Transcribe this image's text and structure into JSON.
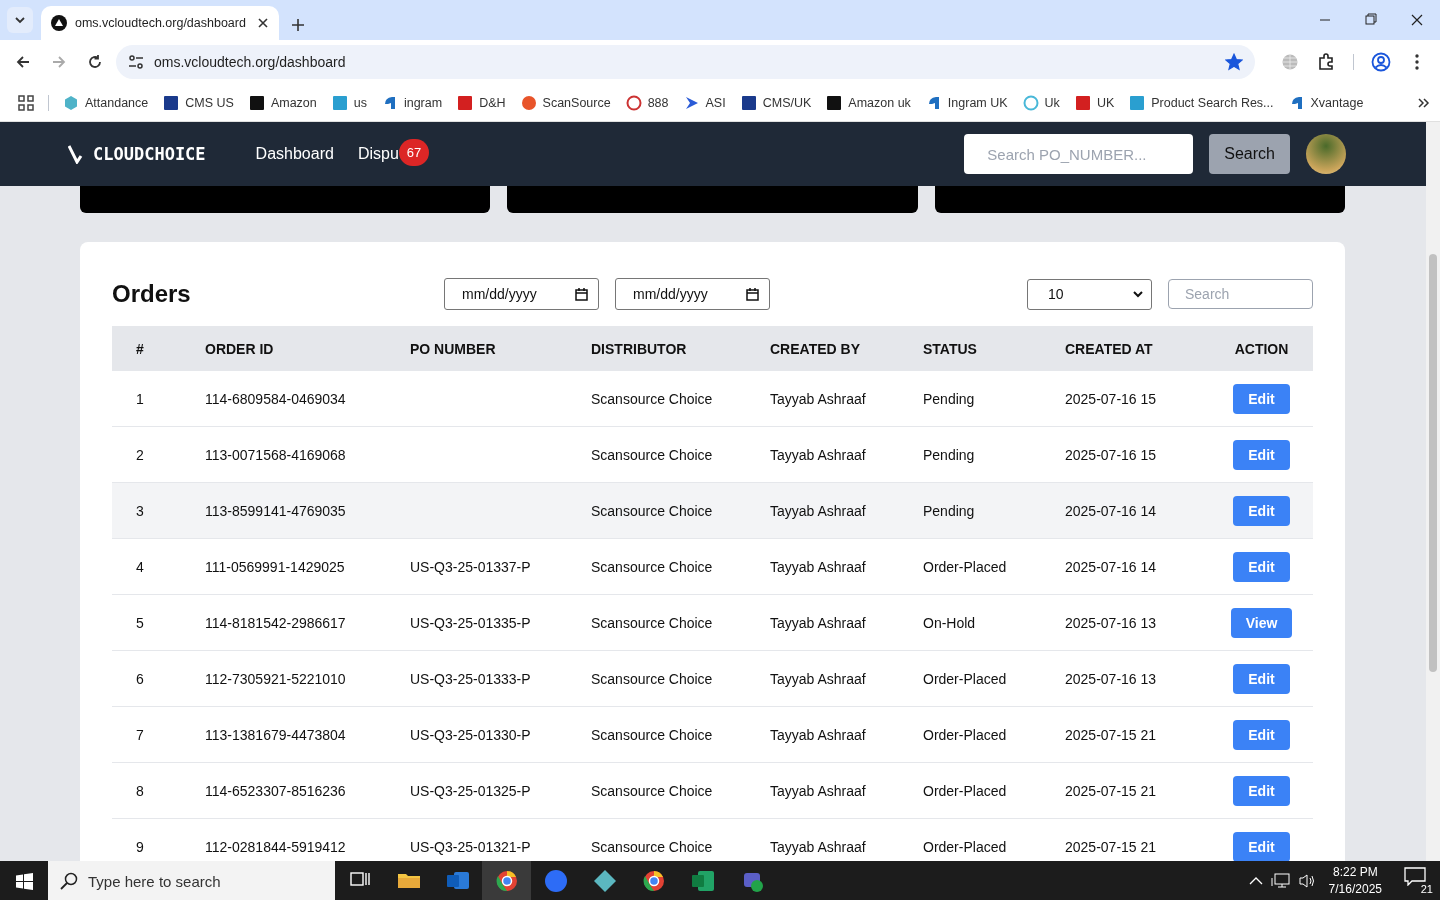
{
  "browser": {
    "tab_title": "oms.vcloudtech.org/dashboard",
    "url": "oms.vcloudtech.org/dashboard",
    "bookmarked": true,
    "bookmarks": [
      {
        "label": "Attandance",
        "kind": "hex"
      },
      {
        "label": "CMS US",
        "kind": "square"
      },
      {
        "label": "Amazon",
        "kind": "amazon"
      },
      {
        "label": "us",
        "kind": "ec"
      },
      {
        "label": "ingram",
        "kind": "ingram"
      },
      {
        "label": "D&H",
        "kind": "red"
      },
      {
        "label": "ScanSource",
        "kind": "scan"
      },
      {
        "label": "888",
        "kind": "rings"
      },
      {
        "label": "ASI",
        "kind": "arrow"
      },
      {
        "label": "CMS/UK",
        "kind": "square"
      },
      {
        "label": "Amazon uk",
        "kind": "amazon"
      },
      {
        "label": "Ingram UK",
        "kind": "ingram"
      },
      {
        "label": "Uk",
        "kind": "circle"
      },
      {
        "label": "UK",
        "kind": "red"
      },
      {
        "label": "Product Search Res...",
        "kind": "ec"
      },
      {
        "label": "Xvantage",
        "kind": "ingram"
      }
    ]
  },
  "header": {
    "logo": "CLOUDCHOICE",
    "nav": [
      {
        "label": "Dashboard"
      },
      {
        "label": "Dispu",
        "badge": "67"
      }
    ],
    "search": {
      "placeholder": "Search PO_NUMBER..."
    },
    "search_button": "Search"
  },
  "orders": {
    "title": "Orders",
    "date_from": "mm/dd/yyyy",
    "date_to": "mm/dd/yyyy",
    "page_size": "10",
    "search": {
      "placeholder": "Search"
    },
    "columns": [
      "#",
      "ORDER ID",
      "PO NUMBER",
      "DISTRIBUTOR",
      "CREATED BY",
      "STATUS",
      "CREATED AT",
      "ACTION"
    ],
    "rows": [
      {
        "num": "1",
        "order_id": "114-6809584-0469034",
        "po_number": "",
        "distributor": "Scansource Choice",
        "created_by": "Tayyab Ashraaf",
        "status": "Pending",
        "created_at": "2025-07-16 15",
        "action": "Edit",
        "highlighted": false
      },
      {
        "num": "2",
        "order_id": "113-0071568-4169068",
        "po_number": "",
        "distributor": "Scansource Choice",
        "created_by": "Tayyab Ashraaf",
        "status": "Pending",
        "created_at": "2025-07-16 15",
        "action": "Edit",
        "highlighted": false
      },
      {
        "num": "3",
        "order_id": "113-8599141-4769035",
        "po_number": "",
        "distributor": "Scansource Choice",
        "created_by": "Tayyab Ashraaf",
        "status": "Pending",
        "created_at": "2025-07-16 14",
        "action": "Edit",
        "highlighted": true
      },
      {
        "num": "4",
        "order_id": "111-0569991-1429025",
        "po_number": "US-Q3-25-01337-P",
        "distributor": "Scansource Choice",
        "created_by": "Tayyab Ashraaf",
        "status": "Order-Placed",
        "created_at": "2025-07-16 14",
        "action": "Edit",
        "highlighted": false
      },
      {
        "num": "5",
        "order_id": "114-8181542-2986617",
        "po_number": "US-Q3-25-01335-P",
        "distributor": "Scansource Choice",
        "created_by": "Tayyab Ashraaf",
        "status": "On-Hold",
        "created_at": "2025-07-16 13",
        "action": "View",
        "highlighted": false
      },
      {
        "num": "6",
        "order_id": "112-7305921-5221010",
        "po_number": "US-Q3-25-01333-P",
        "distributor": "Scansource Choice",
        "created_by": "Tayyab Ashraaf",
        "status": "Order-Placed",
        "created_at": "2025-07-16 13",
        "action": "Edit",
        "highlighted": false
      },
      {
        "num": "7",
        "order_id": "113-1381679-4473804",
        "po_number": "US-Q3-25-01330-P",
        "distributor": "Scansource Choice",
        "created_by": "Tayyab Ashraaf",
        "status": "Order-Placed",
        "created_at": "2025-07-15 21",
        "action": "Edit",
        "highlighted": false
      },
      {
        "num": "8",
        "order_id": "114-6523307-8516236",
        "po_number": "US-Q3-25-01325-P",
        "distributor": "Scansource Choice",
        "created_by": "Tayyab Ashraaf",
        "status": "Order-Placed",
        "created_at": "2025-07-15 21",
        "action": "Edit",
        "highlighted": false
      },
      {
        "num": "9",
        "order_id": "112-0281844-5919412",
        "po_number": "US-Q3-25-01321-P",
        "distributor": "Scansource Choice",
        "created_by": "Tayyab Ashraaf",
        "status": "Order-Placed",
        "created_at": "2025-07-15 21",
        "action": "Edit",
        "highlighted": false
      }
    ]
  },
  "taskbar": {
    "search": {
      "placeholder": "Type here to search"
    },
    "time": "8:22 PM",
    "date": "7/16/2025",
    "notifications": "21"
  }
}
